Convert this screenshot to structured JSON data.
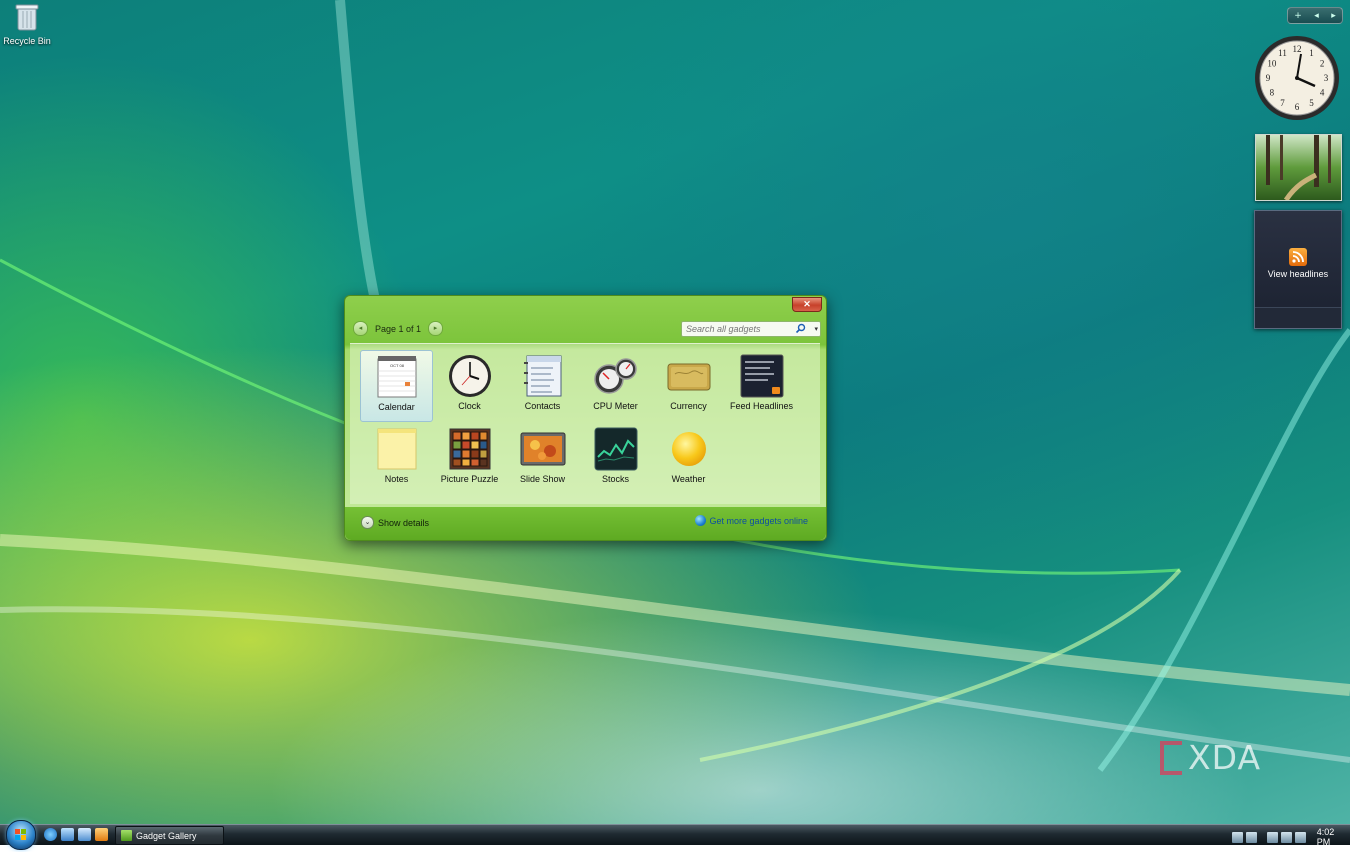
{
  "desktop": {
    "recycle_bin_label": "Recycle Bin",
    "watermark": "XDA"
  },
  "sidebar": {
    "controls": {
      "add": "+",
      "prev": "◂",
      "next": "▸"
    },
    "clock": {
      "numbers": [
        "12",
        "1",
        "2",
        "3",
        "4",
        "5",
        "6",
        "7",
        "8",
        "9",
        "10",
        "11"
      ]
    },
    "feed": {
      "label": "View headlines"
    }
  },
  "gallery": {
    "close": "✕",
    "pager": {
      "prev": "◂",
      "text": "Page 1 of 1",
      "next": "▸"
    },
    "search": {
      "placeholder": "Search all gadgets",
      "dropdown": "▾"
    },
    "gadgets": [
      {
        "label": "Calendar",
        "icon": "calendar-icon",
        "selected": true
      },
      {
        "label": "Clock",
        "icon": "clock-icon"
      },
      {
        "label": "Contacts",
        "icon": "contacts-icon"
      },
      {
        "label": "CPU Meter",
        "icon": "cpu-meter-icon"
      },
      {
        "label": "Currency",
        "icon": "currency-icon"
      },
      {
        "label": "Feed Headlines",
        "icon": "feed-headlines-icon"
      },
      {
        "label": "Notes",
        "icon": "notes-icon"
      },
      {
        "label": "Picture Puzzle",
        "icon": "picture-puzzle-icon"
      },
      {
        "label": "Slide Show",
        "icon": "slide-show-icon"
      },
      {
        "label": "Stocks",
        "icon": "stocks-icon"
      },
      {
        "label": "Weather",
        "icon": "weather-icon"
      }
    ],
    "calendar_icon_text": "OCT 08",
    "show_details": "Show details",
    "show_details_chevron": "⌄",
    "get_more": "Get more gadgets online"
  },
  "taskbar": {
    "window_button": "Gadget Gallery",
    "time": "4:02 PM"
  },
  "colors": {
    "gallery_green": "#7cc43b",
    "link_blue": "#0d4fa0",
    "taskbar_dark": "#1f2a31"
  }
}
